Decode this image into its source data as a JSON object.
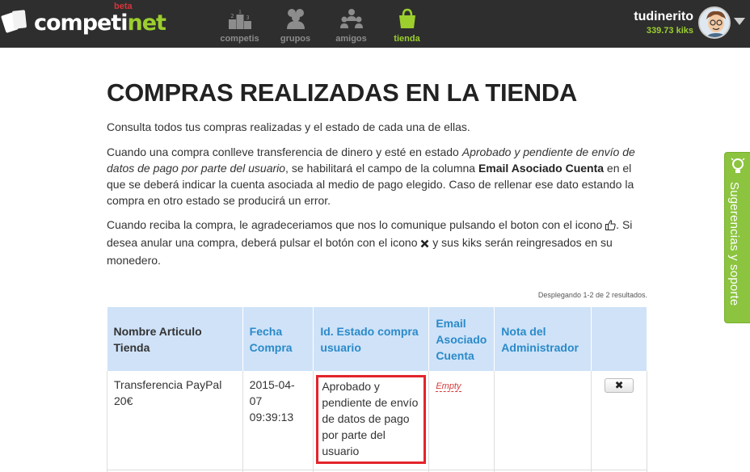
{
  "header": {
    "logo_text_main": "competi",
    "logo_text_accent": "net",
    "logo_beta": "beta",
    "nav": [
      {
        "label": "competis",
        "icon": "podium-icon",
        "active": false
      },
      {
        "label": "grupos",
        "icon": "group-icon",
        "active": false
      },
      {
        "label": "amigos",
        "icon": "friends-icon",
        "active": false
      },
      {
        "label": "tienda",
        "icon": "shopping-bag-icon",
        "active": true
      }
    ],
    "user": {
      "name": "tudinerito",
      "kiks": "339.73 kiks"
    }
  },
  "main": {
    "title": "COMPRAS REALIZADAS EN LA TIENDA",
    "intro": "Consulta todos tus compras realizadas y el estado de cada una de ellas.",
    "p2_a": "Cuando una compra conlleve transferencia de dinero y esté en estado ",
    "p2_em": "Aprobado y pendiente de envío de datos de pago por parte del usuario",
    "p2_b": ", se habilitará el campo de la columna ",
    "p2_strong": "Email Asociado Cuenta",
    "p2_c": " en el que se deberá indicar la cuenta asociada al medio de pago elegido. Caso de rellenar ese dato estando la compra en otro estado se producirá un error.",
    "p3_a": "Cuando reciba la compra, le agradeceriamos que nos lo comunique pulsando el boton con el icono ",
    "p3_b": ". Si desea anular una compra, deberá pulsar el botón con el icono ",
    "p3_c": " y sus kiks serán reingresados en su monedero.",
    "summary": "Desplegando 1-2 de 2 resultados."
  },
  "table": {
    "headers": [
      "Nombre Articulo Tienda",
      "Fecha Compra",
      "Id. Estado compra usuario",
      "Email Asociado Cuenta",
      "Nota del Administrador"
    ],
    "rows": [
      {
        "articulo": "Transferencia PayPal 20€",
        "fecha": "2015-04-07 09:39:13",
        "estado": "Aprobado y pendiente de envío de datos de pago por parte del usuario",
        "email": "Empty",
        "nota": "",
        "action": "✖"
      }
    ]
  },
  "side_tab": {
    "label": "Sugerencias y soporte",
    "icon": "lightbulb-icon"
  },
  "colors": {
    "accent_green": "#9ccf2e",
    "header_bg": "#2e2e2e",
    "table_header_bg": "#cfe2f8",
    "link_blue": "#2a8ac9",
    "highlight_red": "#e3242b"
  }
}
